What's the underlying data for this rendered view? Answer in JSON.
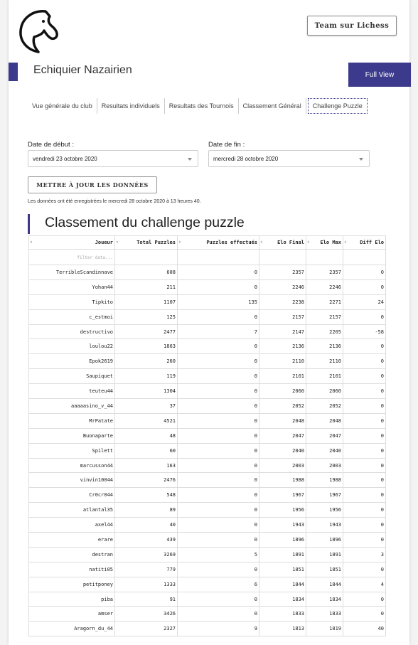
{
  "header": {
    "team_button": "Team sur Lichess",
    "club_title": "Echiquier Nazairien",
    "full_view": "Full View"
  },
  "tabs": [
    "Vue générale du club",
    "Resultats individuels",
    "Resultats des Tournois",
    "Classement Général",
    "Challenge Puzzle"
  ],
  "filters": {
    "start_label": "Date de début :",
    "start_value": "vendredi 23 octobre 2020",
    "end_label": "Date de fin :",
    "end_value": "mercredi 28 octobre 2020",
    "update_button": "METTRE À JOUR LES DONNÉES",
    "note": "Les données ont été enregistrées le mercredi 28 octobre 2020 à 13 heures 40."
  },
  "section_title": "Classement du challenge puzzle",
  "table": {
    "headers": [
      "Joueur",
      "Total Puzzles",
      "Puzzles effectués",
      "Elo Final",
      "Elo Max",
      "Diff Elo"
    ],
    "filter_placeholder": "filter data...",
    "rows": [
      [
        "TerribleScandinnave",
        "608",
        "0",
        "2357",
        "2357",
        "0"
      ],
      [
        "Yohan44",
        "211",
        "0",
        "2246",
        "2246",
        "0"
      ],
      [
        "Tipkito",
        "1107",
        "135",
        "2238",
        "2271",
        "24"
      ],
      [
        "c_estmoi",
        "125",
        "0",
        "2157",
        "2157",
        "0"
      ],
      [
        "destructivo",
        "2477",
        "7",
        "2147",
        "2205",
        "-58"
      ],
      [
        "loulou22",
        "1863",
        "0",
        "2136",
        "2136",
        "0"
      ],
      [
        "Epok2619",
        "260",
        "0",
        "2110",
        "2110",
        "0"
      ],
      [
        "Saupiquet",
        "119",
        "0",
        "2101",
        "2101",
        "0"
      ],
      [
        "teuteu44",
        "1304",
        "0",
        "2060",
        "2060",
        "0"
      ],
      [
        "aaaaasino_v_44",
        "37",
        "0",
        "2052",
        "2052",
        "0"
      ],
      [
        "MrPatate",
        "4521",
        "0",
        "2048",
        "2048",
        "0"
      ],
      [
        "Buonaparte",
        "48",
        "0",
        "2047",
        "2047",
        "0"
      ],
      [
        "Spilett",
        "60",
        "0",
        "2040",
        "2040",
        "0"
      ],
      [
        "marcusson44",
        "163",
        "0",
        "2003",
        "2003",
        "0"
      ],
      [
        "vinvin10044",
        "2476",
        "0",
        "1988",
        "1988",
        "0"
      ],
      [
        "Cr0cr044",
        "548",
        "0",
        "1967",
        "1967",
        "0"
      ],
      [
        "atlantal35",
        "89",
        "0",
        "1956",
        "1956",
        "0"
      ],
      [
        "axel44",
        "40",
        "0",
        "1943",
        "1943",
        "0"
      ],
      [
        "erare",
        "439",
        "0",
        "1896",
        "1896",
        "0"
      ],
      [
        "destran",
        "3269",
        "5",
        "1891",
        "1891",
        "3"
      ],
      [
        "natiti05",
        "779",
        "0",
        "1851",
        "1851",
        "0"
      ],
      [
        "petitponey",
        "1333",
        "6",
        "1844",
        "1844",
        "4"
      ],
      [
        "piba",
        "91",
        "0",
        "1834",
        "1834",
        "0"
      ],
      [
        "amser",
        "3426",
        "0",
        "1833",
        "1833",
        "0"
      ],
      [
        "Aragorn_du_44",
        "2327",
        "9",
        "1813",
        "1819",
        "40"
      ]
    ]
  }
}
